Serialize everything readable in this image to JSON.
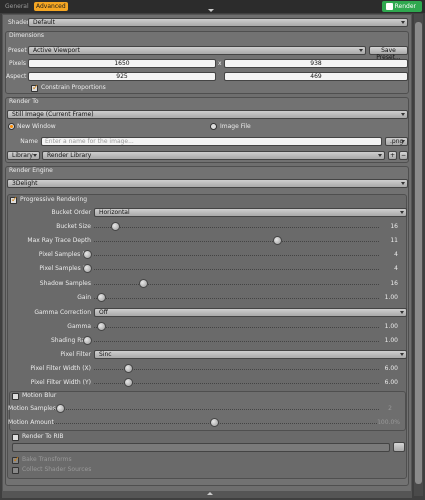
{
  "topbar": {
    "tab_general": "General",
    "tab_advanced": "Advanced",
    "render_button": "Render"
  },
  "shader": {
    "label": "Shader",
    "value": "Default"
  },
  "dimensions": {
    "title": "Dimensions",
    "preset_label": "Preset",
    "preset_value": "Active Viewport",
    "save_preset": "Save Preset...",
    "pixels_label": "Pixels",
    "pixels_w": "1650",
    "pixels_sep": "x",
    "pixels_h": "938",
    "aspect_label": "Aspect",
    "aspect_w": "925",
    "aspect_h": "469",
    "constrain_label": "Constrain Proportions"
  },
  "render_to": {
    "title": "Render To",
    "value": "Still Image (Current Frame)",
    "new_window": "New Window",
    "image_file": "Image File",
    "name_label": "Name",
    "name_placeholder": "Enter a name for the image...",
    "ext": ".png",
    "library_dd": "Library",
    "library_value": "Render Library",
    "plus": "+",
    "minus": "−"
  },
  "engine": {
    "title": "Render Engine",
    "value": "3Delight",
    "progressive": "Progressive Rendering",
    "bucket_order_label": "Bucket Order",
    "bucket_order_value": "Horizontal",
    "sliders": [
      {
        "label": "Bucket Size",
        "value": "16"
      },
      {
        "label": "Max Ray Trace Depth",
        "value": "11"
      },
      {
        "label": "Pixel Samples (X)",
        "value": "4"
      },
      {
        "label": "Pixel Samples (Y)",
        "value": "4"
      },
      {
        "label": "Shadow Samples",
        "value": "16"
      },
      {
        "label": "Gain",
        "value": "1.00"
      }
    ],
    "gamma_corr_label": "Gamma Correction",
    "gamma_corr_value": "Off",
    "sliders2": [
      {
        "label": "Gamma",
        "value": "1.00"
      },
      {
        "label": "Shading Rate",
        "value": "1.00"
      }
    ],
    "pixel_filter_label": "Pixel Filter",
    "pixel_filter_value": "Sinc",
    "sliders3": [
      {
        "label": "Pixel Filter Width (X)",
        "value": "6.00"
      },
      {
        "label": "Pixel Filter Width (Y)",
        "value": "6.00"
      }
    ],
    "motion_blur": "Motion Blur",
    "motion_samples_label": "Motion Samples",
    "motion_samples_value": "2",
    "motion_amount_label": "Motion Amount",
    "motion_amount_value": "100.0%",
    "render_to_rib": "Render To RIB",
    "rib_extra_1": "Bake Transforms",
    "rib_extra_2": "Collect Shader Sources"
  }
}
